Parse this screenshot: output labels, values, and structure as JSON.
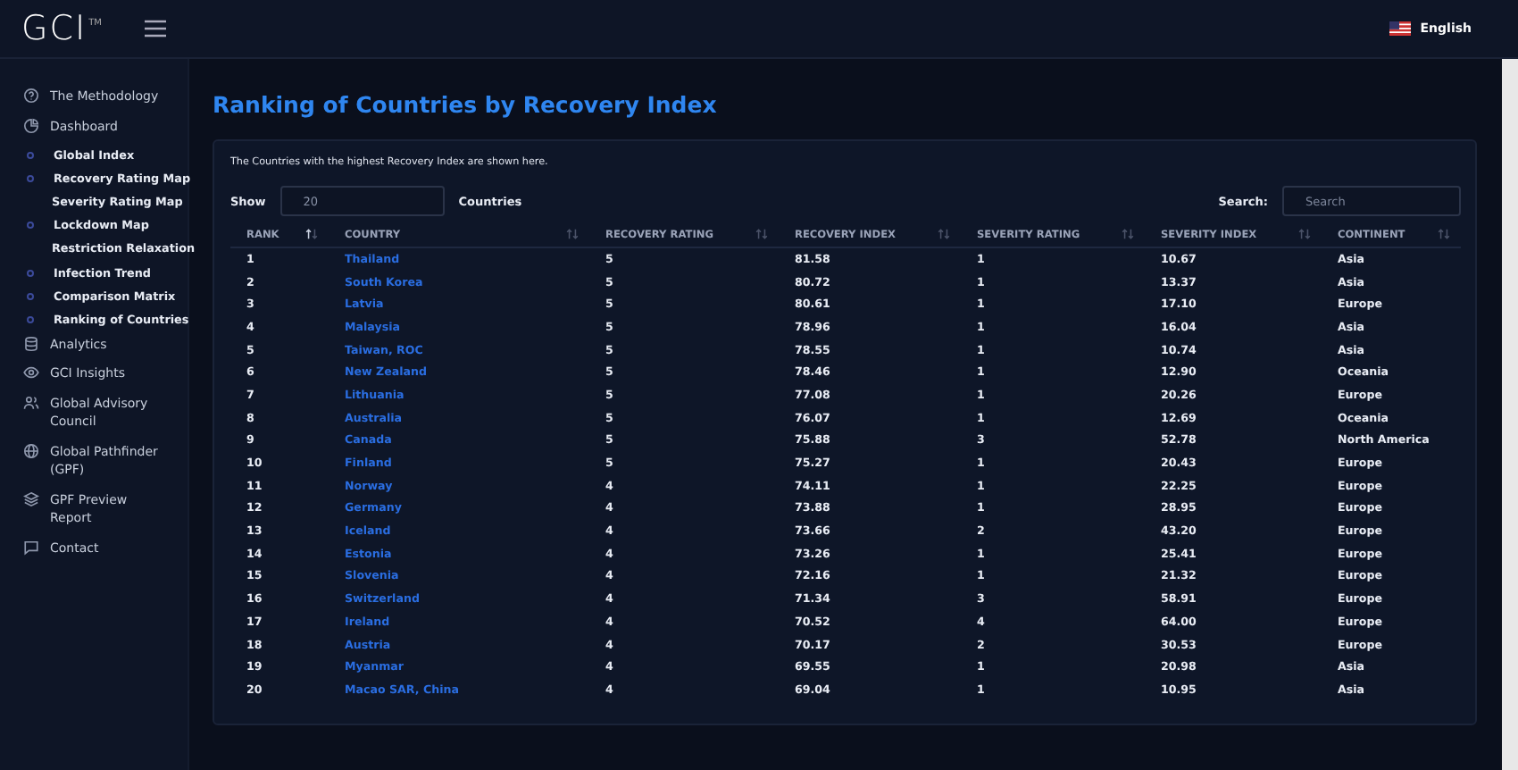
{
  "logo": {
    "text": "GCI",
    "mark": "TM"
  },
  "language": "English",
  "sidebar": {
    "items": [
      {
        "label": "The Methodology"
      },
      {
        "label": "Dashboard",
        "children": [
          {
            "label": "Global Index",
            "bullet": true
          },
          {
            "label": "Recovery Rating Map",
            "bullet": true
          },
          {
            "label": "Severity Rating Map",
            "bullet": false
          },
          {
            "label": "Lockdown Map",
            "bullet": true
          },
          {
            "label": "Restriction Relaxation",
            "bullet": false
          },
          {
            "label": "Infection Trend",
            "bullet": true
          },
          {
            "label": "Comparison Matrix",
            "bullet": true
          },
          {
            "label": "Ranking of Countries",
            "bullet": true
          }
        ]
      },
      {
        "label": "Analytics"
      },
      {
        "label": "GCI Insights"
      },
      {
        "label": "Global Advisory Council"
      },
      {
        "label": "Global Pathfinder (GPF)"
      },
      {
        "label": "GPF Preview Report"
      },
      {
        "label": "Contact"
      }
    ]
  },
  "page_title": "Ranking of Countries by Recovery Index",
  "card": {
    "description": "The Countries with the highest Recovery Index are shown here.",
    "show_label": "Show",
    "show_value": "20",
    "show_suffix": "Countries",
    "search_label": "Search:",
    "search_placeholder": "Search"
  },
  "table": {
    "columns": [
      {
        "label": "RANK",
        "sorted": true
      },
      {
        "label": "COUNTRY",
        "sorted": false
      },
      {
        "label": "RECOVERY RATING",
        "sorted": false
      },
      {
        "label": "RECOVERY INDEX",
        "sorted": false
      },
      {
        "label": "SEVERITY RATING",
        "sorted": false
      },
      {
        "label": "SEVERITY INDEX",
        "sorted": false
      },
      {
        "label": "CONTINENT",
        "sorted": false
      }
    ],
    "rows": [
      [
        "1",
        "Thailand",
        "5",
        "81.58",
        "1",
        "10.67",
        "Asia"
      ],
      [
        "2",
        "South Korea",
        "5",
        "80.72",
        "1",
        "13.37",
        "Asia"
      ],
      [
        "3",
        "Latvia",
        "5",
        "80.61",
        "1",
        "17.10",
        "Europe"
      ],
      [
        "4",
        "Malaysia",
        "5",
        "78.96",
        "1",
        "16.04",
        "Asia"
      ],
      [
        "5",
        "Taiwan, ROC",
        "5",
        "78.55",
        "1",
        "10.74",
        "Asia"
      ],
      [
        "6",
        "New Zealand",
        "5",
        "78.46",
        "1",
        "12.90",
        "Oceania"
      ],
      [
        "7",
        "Lithuania",
        "5",
        "77.08",
        "1",
        "20.26",
        "Europe"
      ],
      [
        "8",
        "Australia",
        "5",
        "76.07",
        "1",
        "12.69",
        "Oceania"
      ],
      [
        "9",
        "Canada",
        "5",
        "75.88",
        "3",
        "52.78",
        "North America"
      ],
      [
        "10",
        "Finland",
        "5",
        "75.27",
        "1",
        "20.43",
        "Europe"
      ],
      [
        "11",
        "Norway",
        "4",
        "74.11",
        "1",
        "22.25",
        "Europe"
      ],
      [
        "12",
        "Germany",
        "4",
        "73.88",
        "1",
        "28.95",
        "Europe"
      ],
      [
        "13",
        "Iceland",
        "4",
        "73.66",
        "2",
        "43.20",
        "Europe"
      ],
      [
        "14",
        "Estonia",
        "4",
        "73.26",
        "1",
        "25.41",
        "Europe"
      ],
      [
        "15",
        "Slovenia",
        "4",
        "72.16",
        "1",
        "21.32",
        "Europe"
      ],
      [
        "16",
        "Switzerland",
        "4",
        "71.34",
        "3",
        "58.91",
        "Europe"
      ],
      [
        "17",
        "Ireland",
        "4",
        "70.52",
        "4",
        "64.00",
        "Europe"
      ],
      [
        "18",
        "Austria",
        "4",
        "70.17",
        "2",
        "30.53",
        "Europe"
      ],
      [
        "19",
        "Myanmar",
        "4",
        "69.55",
        "1",
        "20.98",
        "Asia"
      ],
      [
        "20",
        "Macao SAR, China",
        "4",
        "69.04",
        "1",
        "10.95",
        "Asia"
      ]
    ]
  }
}
